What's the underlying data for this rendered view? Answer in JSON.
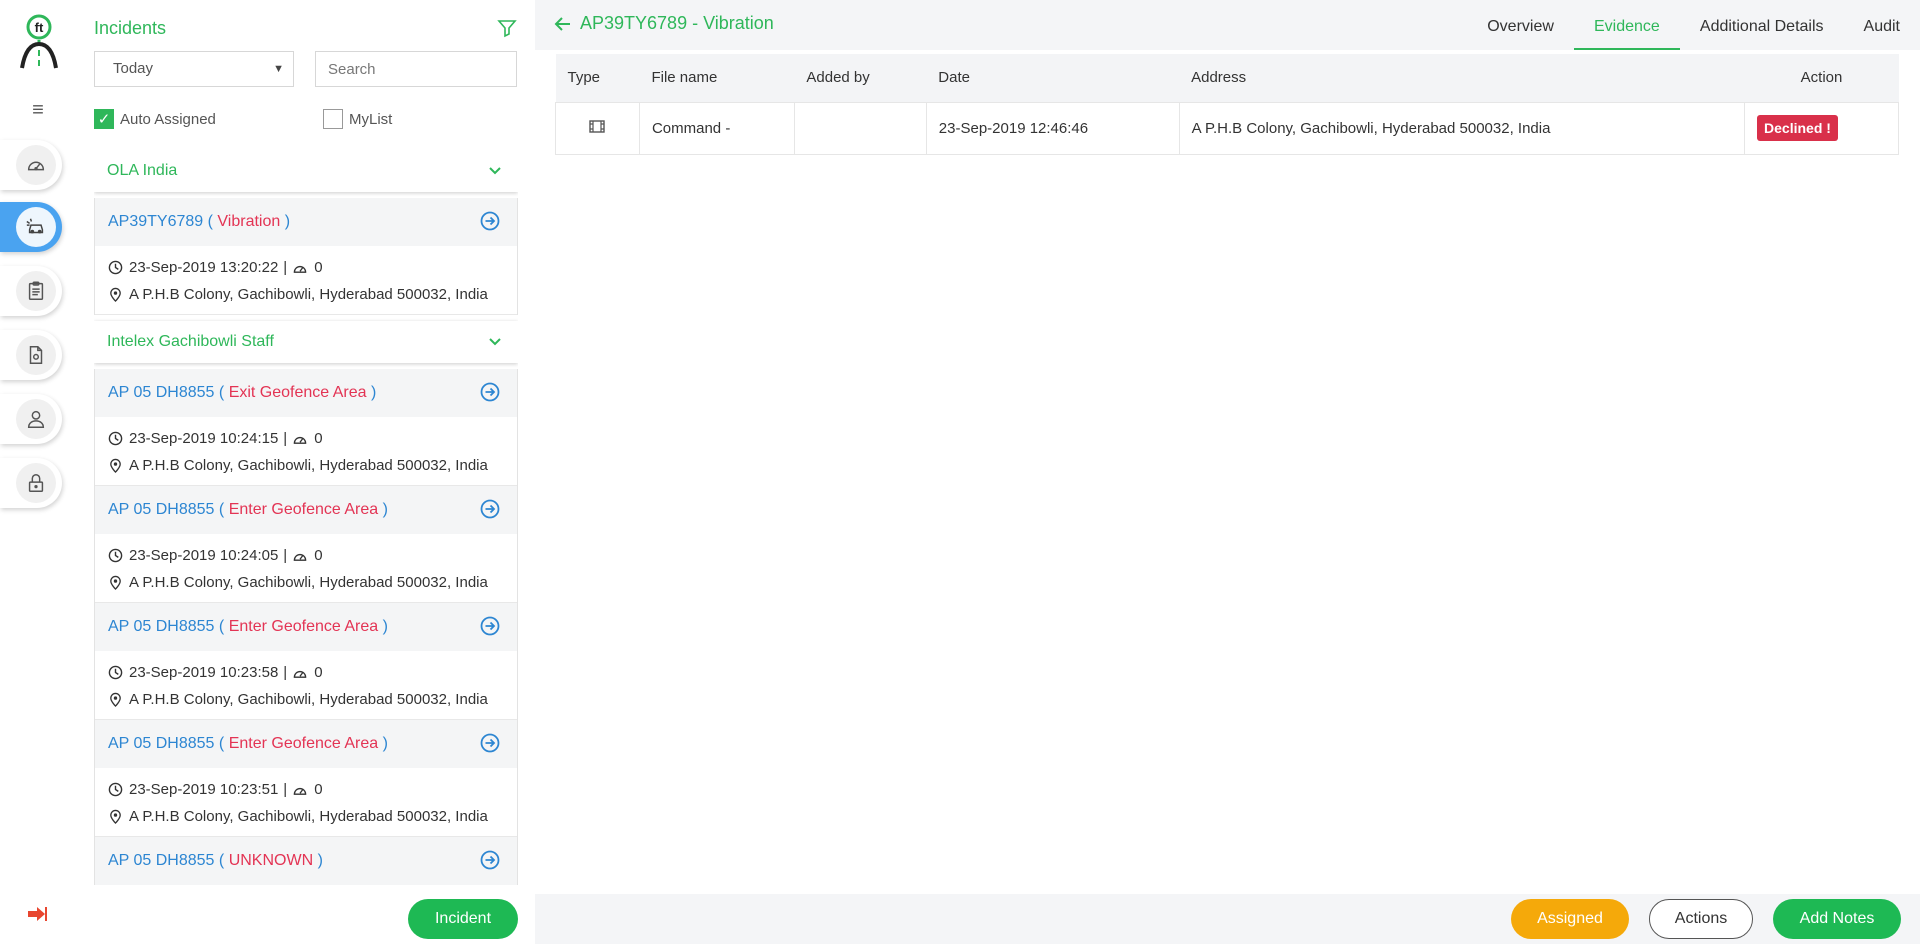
{
  "sidebar": {
    "logo_text": "ft",
    "items": [
      {
        "name": "dashboard"
      },
      {
        "name": "incidents"
      },
      {
        "name": "reports"
      },
      {
        "name": "documents"
      },
      {
        "name": "users"
      },
      {
        "name": "security"
      }
    ]
  },
  "panel": {
    "title": "Incidents",
    "date_filter": "Today",
    "search_placeholder": "Search",
    "auto_assigned_label": "Auto Assigned",
    "mylist_label": "MyList",
    "incident_button": "Incident",
    "groups": [
      {
        "name": "OLA India",
        "incidents": [
          {
            "vehicle": "AP39TY6789",
            "event": "Vibration",
            "datetime": "23-Sep-2019 13:20:22",
            "speed": "0",
            "address": "A P.H.B Colony, Gachibowli, Hyderabad 500032, India"
          }
        ]
      },
      {
        "name": "Intelex Gachibowli Staff",
        "incidents": [
          {
            "vehicle": "AP 05 DH8855",
            "event": "Exit Geofence Area",
            "datetime": "23-Sep-2019 10:24:15",
            "speed": "0",
            "address": "A P.H.B Colony, Gachibowli, Hyderabad 500032, India"
          },
          {
            "vehicle": "AP 05 DH8855",
            "event": "Enter Geofence Area",
            "datetime": "23-Sep-2019 10:24:05",
            "speed": "0",
            "address": "A P.H.B Colony, Gachibowli, Hyderabad 500032, India"
          },
          {
            "vehicle": "AP 05 DH8855",
            "event": "Enter Geofence Area",
            "datetime": "23-Sep-2019 10:23:58",
            "speed": "0",
            "address": "A P.H.B Colony, Gachibowli, Hyderabad 500032, India"
          },
          {
            "vehicle": "AP 05 DH8855",
            "event": "Enter Geofence Area",
            "datetime": "23-Sep-2019 10:23:51",
            "speed": "0",
            "address": "A P.H.B Colony, Gachibowli, Hyderabad 500032, India"
          },
          {
            "vehicle": "AP 05 DH8855",
            "event": "UNKNOWN",
            "datetime": "",
            "speed": "",
            "address": ""
          }
        ]
      }
    ]
  },
  "main": {
    "title": "AP39TY6789 - Vibration",
    "tabs": [
      {
        "label": "Overview",
        "active": false
      },
      {
        "label": "Evidence",
        "active": true
      },
      {
        "label": "Additional Details",
        "active": false
      },
      {
        "label": "Audit",
        "active": false
      }
    ],
    "table": {
      "headers": {
        "type": "Type",
        "file_name": "File name",
        "added_by": "Added by",
        "date": "Date",
        "address": "Address",
        "action": "Action"
      },
      "rows": [
        {
          "type_icon": "film-icon",
          "file_name": "Command -",
          "added_by": "",
          "date": "23-Sep-2019 12:46:46",
          "address": "A P.H.B Colony, Gachibowli, Hyderabad 500032, India",
          "action": "Declined !"
        }
      ]
    }
  },
  "footer": {
    "assigned_label": "Assigned",
    "actions_label": "Actions",
    "add_notes_label": "Add Notes"
  },
  "colors": {
    "brand_green": "#2fb75a",
    "link_blue": "#2d86d2",
    "event_red": "#e33454",
    "declined_red": "#d9304a",
    "assigned_orange": "#f5a90a"
  }
}
